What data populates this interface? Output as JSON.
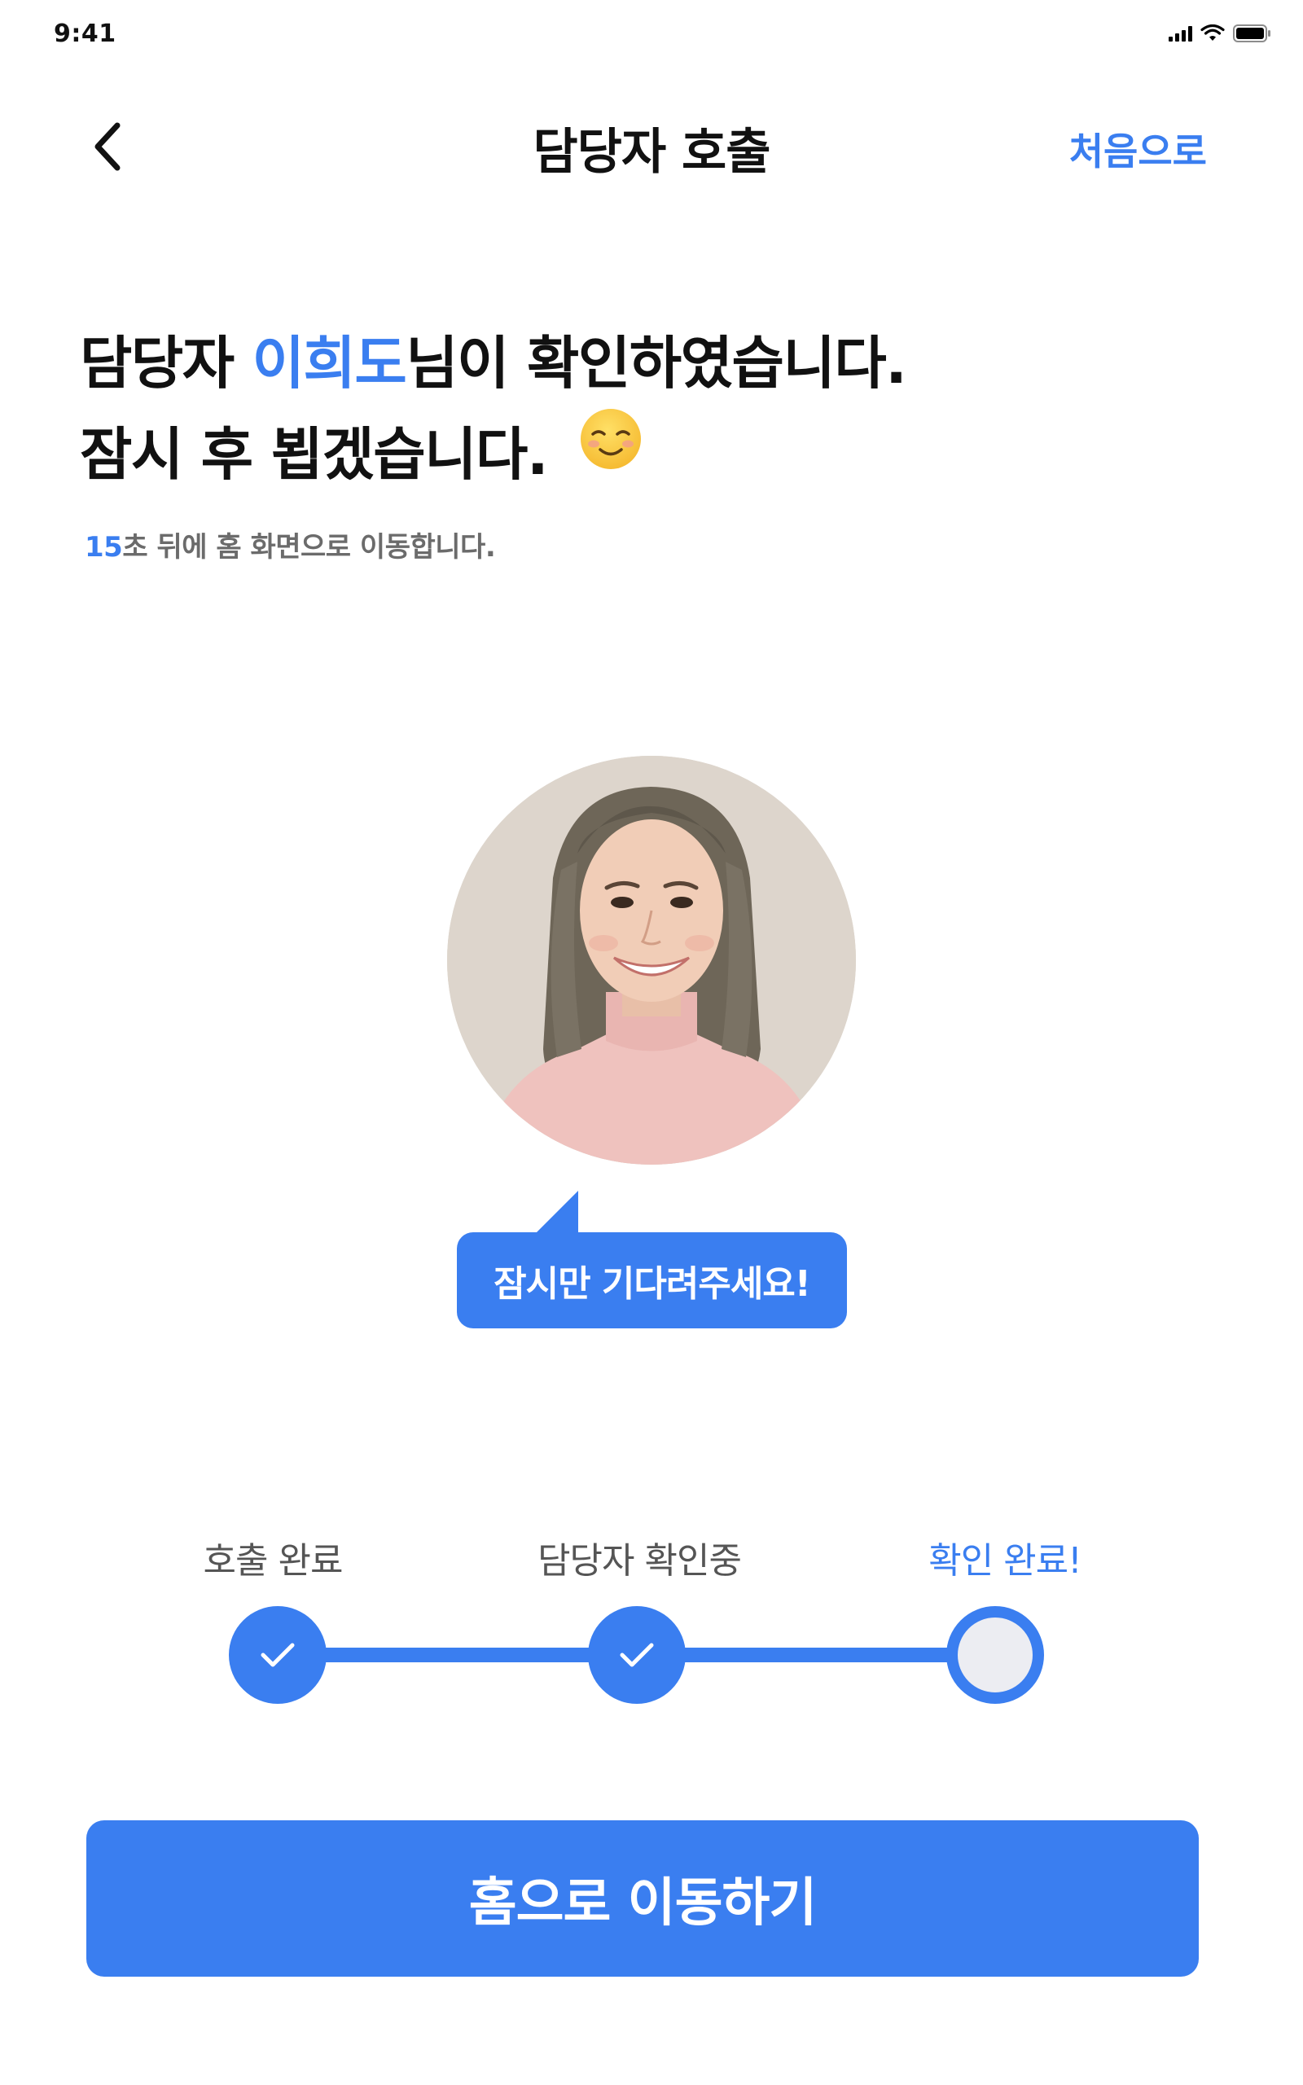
{
  "status_bar": {
    "time": "9:41"
  },
  "nav": {
    "title": "담당자 호출",
    "action_label": "처음으로",
    "back_icon": "chevron-left-icon"
  },
  "headline": {
    "line1_prefix": "담당자 ",
    "staff_name": "이희도",
    "line1_suffix": "님이 확인하였습니다.",
    "line2": "잠시 후 뵙겠습니다.",
    "emoji": "smiling-face-icon"
  },
  "countdown": {
    "seconds": "15",
    "message": "초 뒤에 홈 화면으로 이동합니다."
  },
  "staff_photo": {
    "description_icon": "avatar"
  },
  "bubble": {
    "text": "잠시만 기다려주세요!"
  },
  "progress": {
    "steps": [
      {
        "label": "호출 완료",
        "state": "done"
      },
      {
        "label": "담당자 확인중",
        "state": "done"
      },
      {
        "label": "확인 완료!",
        "state": "current"
      }
    ]
  },
  "footer": {
    "home_button_label": "홈으로 이동하기"
  },
  "colors": {
    "accent": "#3A7EF0",
    "text": "#111111",
    "muted": "#6b6b6b",
    "pending_dot": "#ECEDF2"
  }
}
